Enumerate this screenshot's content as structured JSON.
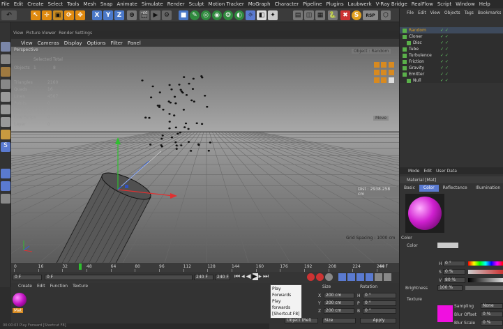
{
  "menubar": [
    "File",
    "Edit",
    "Create",
    "Select",
    "Tools",
    "Mesh",
    "Snap",
    "Animate",
    "Simulate",
    "Render",
    "Sculpt",
    "Motion Tracker",
    "MoGraph",
    "Character",
    "Pipeline",
    "Plugins",
    "Laubwerk",
    "V-Ray Bridge",
    "RealFlow",
    "Script",
    "Window",
    "Help"
  ],
  "toolbar": {
    "x": "X",
    "y": "Y",
    "z": "Z"
  },
  "view_tabs": [
    "View",
    "Picture Viewer",
    "Render Settings"
  ],
  "view_menu": [
    "View",
    "Cameras",
    "Display",
    "Options",
    "Filter",
    "Panel"
  ],
  "viewport": {
    "label": "Perspective",
    "hud_header": "Selected Total",
    "hud_objects_label": "Objects",
    "hud_objects_val1": "1",
    "hud_objects_val2": "8",
    "stats": [
      {
        "k": "Triangles",
        "v": "2160"
      },
      {
        "k": "Quads",
        "v": "16"
      },
      {
        "k": "Lines",
        "v": "4567"
      },
      {
        "k": "Points",
        "v": "0"
      },
      {
        "k": "Triangle Strips",
        "v": "0"
      },
      {
        "k": "Line Strips",
        "v": "0"
      },
      {
        "k": "Layer",
        "v": "0"
      }
    ],
    "camera_dropdown": "Object : Random",
    "move_label": "Move",
    "dist": "Dist : 2938.258 cm",
    "grid": "Grid Spacing : 1000 cm"
  },
  "timeline": {
    "ticks": [
      "0",
      "16",
      "32",
      "48",
      "64",
      "80",
      "96",
      "112",
      "128",
      "144",
      "160",
      "176",
      "192",
      "208",
      "224",
      "240"
    ],
    "current": "44 F",
    "current_frame": 44,
    "frame_max": 240
  },
  "transport": {
    "start": "0 F",
    "field2": "0 F",
    "end": "240 F",
    "end2": "240 F"
  },
  "tooltip": [
    "Play Forwards",
    "Play forwards",
    "[Shortcut F8]"
  ],
  "material_panel": {
    "menu": [
      "Create",
      "Edit",
      "Function",
      "Texture"
    ],
    "material_name": "Mat"
  },
  "coord_panel": {
    "headers": [
      "Size",
      "Rotation"
    ],
    "rows": [
      {
        "axis": "X",
        "size": "200 cm",
        "rot_label": "H",
        "rot": "0 °"
      },
      {
        "axis": "Y",
        "size": "200 cm",
        "rot_label": "P",
        "rot": "0 °"
      },
      {
        "axis": "Z",
        "size": "200 cm",
        "rot_label": "B",
        "rot": "0 °"
      }
    ],
    "mode": "Object (Rel)",
    "size_mode": "Size",
    "apply": "Apply"
  },
  "object_manager": {
    "menu": [
      "File",
      "Edit",
      "View",
      "Objects",
      "Tags",
      "Bookmarks"
    ],
    "objects": [
      {
        "name": "Random",
        "color": "#e0a020"
      },
      {
        "name": "Cloner",
        "color": "#ddd"
      },
      {
        "name": "Disc",
        "color": "#ddd"
      },
      {
        "name": "Tube",
        "color": "#ddd"
      },
      {
        "name": "Turbulence",
        "color": "#ddd"
      },
      {
        "name": "Friction",
        "color": "#ddd"
      },
      {
        "name": "Gravity",
        "color": "#ddd"
      },
      {
        "name": "Emitter",
        "color": "#ddd"
      },
      {
        "name": "Null",
        "color": "#ddd"
      }
    ]
  },
  "attributes": {
    "menu": [
      "Mode",
      "Edit",
      "User Data"
    ],
    "title": "Material [Mat]",
    "tabs": [
      "Basic",
      "Color",
      "Reflectance",
      "Illumination"
    ],
    "section": "Color",
    "color_label": "Color",
    "h_label": "H",
    "h_val": "0 °",
    "s_label": "S",
    "s_val": "0 %",
    "v_label": "V",
    "v_val": "80 %",
    "brightness_label": "Brightness",
    "brightness_val": "100 %",
    "texture_label": "Texture",
    "sampling_label": "Sampling",
    "sampling_val": "None",
    "blur_offset_label": "Blur Offset",
    "blur_offset_val": "0 %",
    "blur_scale_label": "Blur Scale",
    "blur_scale_val": "0 %"
  },
  "statusbar": "00:00:03   Play Forward [Shortcut F8]"
}
